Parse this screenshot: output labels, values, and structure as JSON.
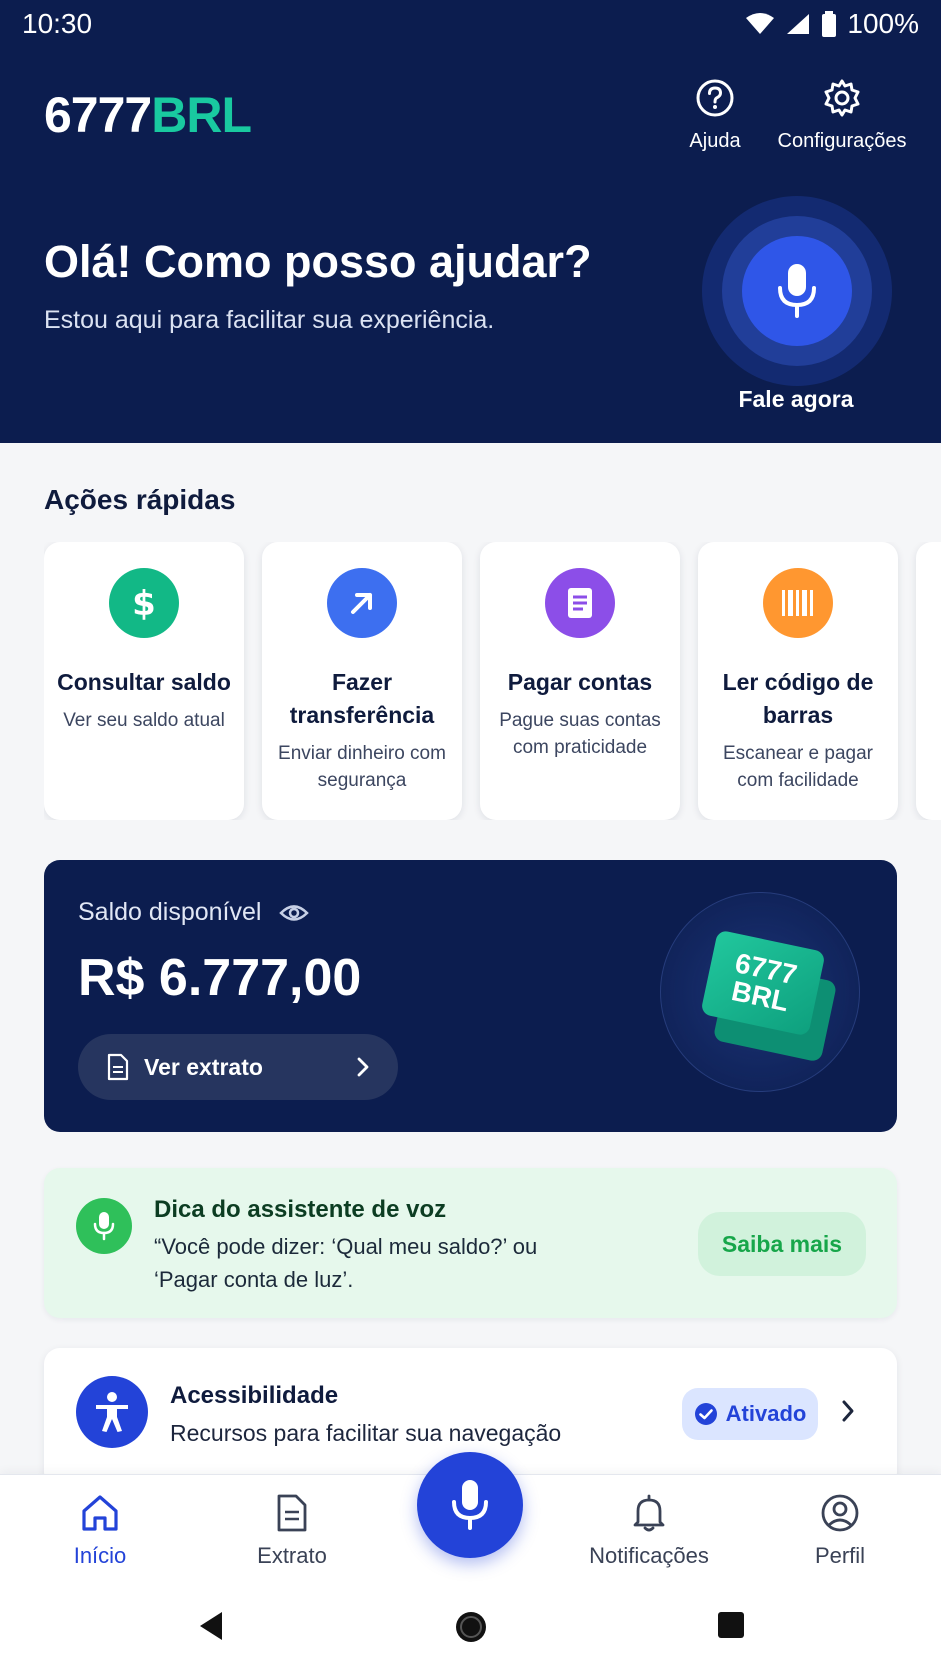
{
  "status_bar": {
    "time": "10:30",
    "battery": "100%"
  },
  "header": {
    "logo_part1": "6777",
    "logo_part2": "BRL",
    "help_label": "Ajuda",
    "settings_label": "Configurações",
    "greeting_title": "Olá! Como posso ajudar?",
    "greeting_subtitle": "Estou aqui para facilitar sua experiência.",
    "voice_label": "Fale agora"
  },
  "quick_actions": {
    "title": "Ações rápidas",
    "items": [
      {
        "title": "Consultar saldo",
        "description": "Ver seu saldo atual",
        "icon": "dollar-icon",
        "color": "#12b886"
      },
      {
        "title": "Fazer transferência",
        "description": "Enviar dinheiro com segurança",
        "icon": "arrow-up-right-icon",
        "color": "#3d6ff0"
      },
      {
        "title": "Pagar contas",
        "description": "Pague suas contas com praticidade",
        "icon": "document-icon",
        "color": "#8c4ee8"
      },
      {
        "title": "Ler código de barras",
        "description": "Escanear e pagar com facilidade",
        "icon": "barcode-icon",
        "color": "#ff9730"
      }
    ]
  },
  "balance": {
    "label": "Saldo disponível",
    "value": "R$ 6.777,00",
    "statement_button": "Ver extrato",
    "brand_line1": "6777",
    "brand_line2": "BRL"
  },
  "tip": {
    "title": "Dica do assistente de voz",
    "text": "“Você pode dizer: ‘Qual meu saldo?’ ou ‘Pagar conta de luz’.",
    "button": "Saiba mais"
  },
  "accessibility": {
    "title": "Acessibilidade",
    "subtitle": "Recursos para facilitar sua navegação",
    "badge": "Ativado"
  },
  "bottom_nav": {
    "home": "Início",
    "statement": "Extrato",
    "notifications": "Notificações",
    "profile": "Perfil"
  },
  "colors": {
    "primary_dark": "#0c1d4f",
    "primary_blue": "#2343d8",
    "accent_green": "#19c9a0"
  }
}
